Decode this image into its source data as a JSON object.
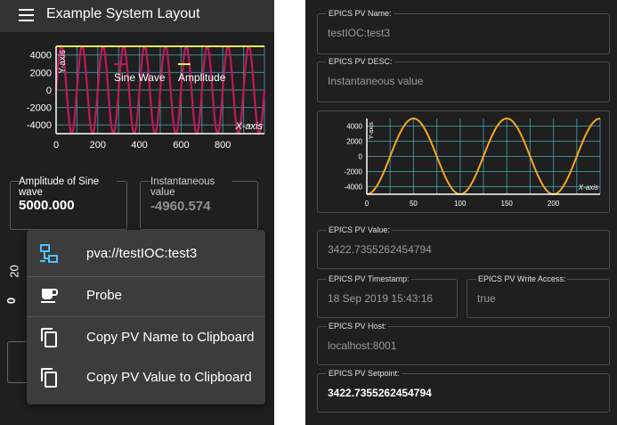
{
  "left": {
    "app_title": "Example System Layout",
    "chart": {
      "legend": [
        "Sine Wave",
        "Amplitude"
      ],
      "xlabel": "X-axis",
      "ylabel": "Y-axis",
      "xticks": [
        "0",
        "200",
        "400",
        "600",
        "800"
      ],
      "yticks": [
        "4000",
        "2000",
        "0",
        "-2000",
        "-4000"
      ],
      "colors": {
        "sine": "#c2185b",
        "amplitude": "#e6ee58",
        "grid": "#4db6c4"
      }
    },
    "amplitude_field": {
      "label": "Amplitude of Sine wave",
      "value": "5000.000"
    },
    "instant_field": {
      "label": "Instantaneous value",
      "value": "-4960.574"
    },
    "partial_slider_labels": [
      "0",
      "20"
    ],
    "context_menu": {
      "items": [
        {
          "label": "pva://testIOC:test3",
          "icon": "network-icon"
        },
        {
          "label": "Probe",
          "icon": "coffee-icon"
        },
        {
          "label": "Copy PV Name to Clipboard",
          "icon": "copy-icon"
        },
        {
          "label": "Copy PV Value to Clipboard",
          "icon": "copy-icon"
        }
      ]
    }
  },
  "right": {
    "pv_name": {
      "label": "EPICS PV Name:",
      "value": "testIOC:test3"
    },
    "pv_desc": {
      "label": "EPICS PV DESC:",
      "value": "Instantaneous value"
    },
    "chart": {
      "xlabel": "X-axis",
      "ylabel": "Y-axis",
      "xticks": [
        "0",
        "50",
        "100",
        "150",
        "200"
      ],
      "yticks": [
        "4000",
        "2000",
        "0",
        "-2000",
        "-4000"
      ],
      "colors": {
        "line": "#f5a623",
        "grid": "#4db6c4"
      }
    },
    "pv_value": {
      "label": "EPICS PV Value:",
      "value": "3422.7355262454794"
    },
    "pv_timestamp": {
      "label": "EPICS PV Timestamp:",
      "value": "18 Sep 2019 15:43:16"
    },
    "pv_write": {
      "label": "EPICS PV Write Access:",
      "value": "true"
    },
    "pv_host": {
      "label": "EPICS PV Host:",
      "value": "localhost:8001"
    },
    "pv_setpoint": {
      "label": "EPICS PV Setpoint:",
      "value": "3422.7355262454794"
    }
  },
  "chart_data": [
    {
      "type": "line",
      "xlabel": "X-axis",
      "ylabel": "Y-axis",
      "xlim": [
        0,
        1000
      ],
      "ylim": [
        -5000,
        5000
      ],
      "grid": true,
      "legend_position": "top-center",
      "series": [
        {
          "name": "Sine Wave",
          "function": "5000*sin(2*pi*x/100)",
          "x_range": [
            0,
            1000
          ]
        },
        {
          "name": "Amplitude",
          "x": [
            0,
            1000
          ],
          "values": [
            5000,
            5000
          ]
        }
      ]
    },
    {
      "type": "line",
      "xlabel": "X-axis",
      "ylabel": "Y-axis",
      "xlim": [
        0,
        250
      ],
      "ylim": [
        -5000,
        5000
      ],
      "grid": true,
      "series": [
        {
          "function": "-5000*cos(2*pi*x/100)",
          "x_range": [
            0,
            250
          ]
        }
      ]
    }
  ]
}
